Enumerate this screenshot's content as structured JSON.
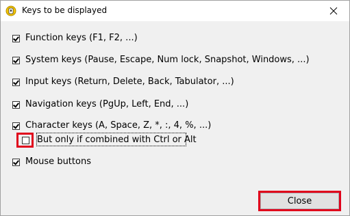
{
  "window": {
    "title": "Keys to be displayed"
  },
  "options": [
    {
      "label": "Function keys (F1, F2, ...)",
      "checked": true
    },
    {
      "label": "System keys (Pause, Escape, Num lock, Snapshot, Windows, ...)",
      "checked": true
    },
    {
      "label": "Input keys (Return, Delete, Back, Tabulator, ...)",
      "checked": true
    },
    {
      "label": "Navigation keys (PgUp, Left, End, ...)",
      "checked": true
    },
    {
      "label": "Character keys (A, Space, Z, *, :, 4, %, ...)",
      "checked": true
    },
    {
      "label": "But only if combined with Ctrl or Alt",
      "checked": false
    },
    {
      "label": "Mouse buttons",
      "checked": true
    }
  ],
  "buttons": {
    "close_label": "Close"
  },
  "colors": {
    "highlight": "#e0001b",
    "dialog_bg": "#f0f0f0",
    "button_bg": "#e1e1e1"
  },
  "icons": {
    "app": "app-icon",
    "close": "close-icon"
  }
}
